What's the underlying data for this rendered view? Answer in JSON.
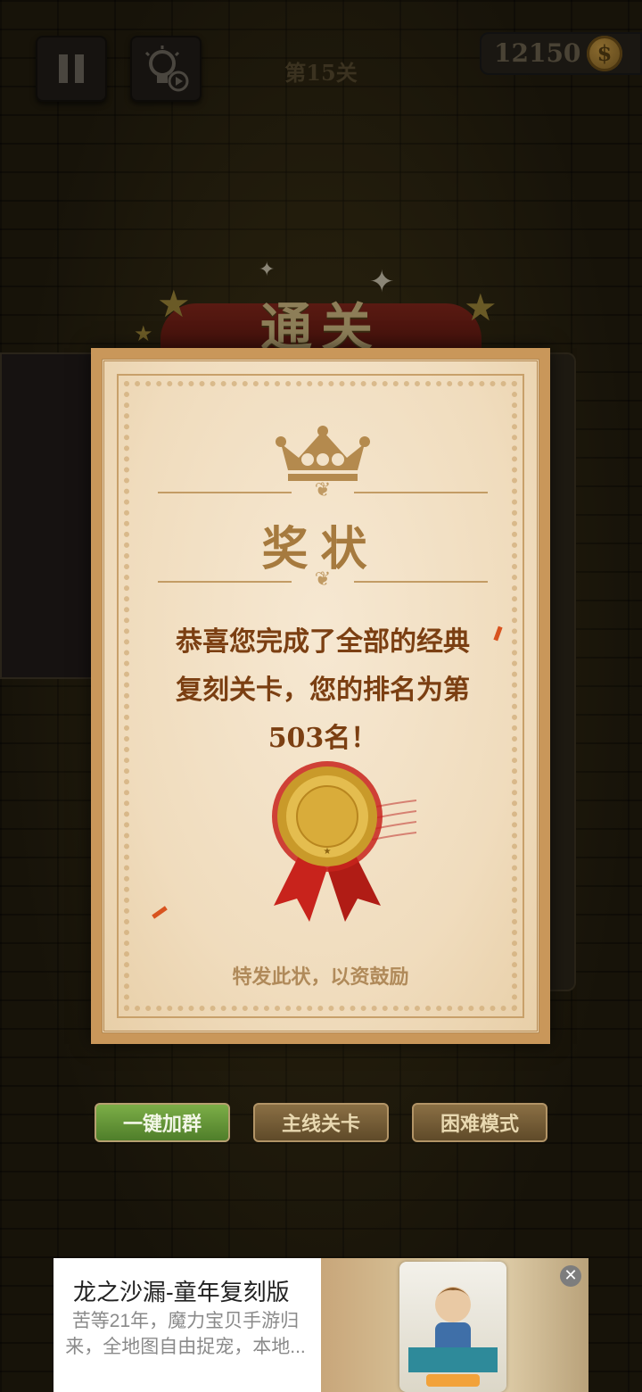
{
  "hud": {
    "level_title": "第15关",
    "coins": "12150",
    "coin_symbol": "$"
  },
  "banner": {
    "title": "通关"
  },
  "certificate": {
    "title": "奖状",
    "message": "恭喜您完成了全部的经典复刻关卡，您的排名为第503名！",
    "closing": "特发此状，以资鼓励"
  },
  "buttons": {
    "join_group": "一键加群",
    "main_levels": "主线关卡",
    "hard_mode": "困难模式"
  },
  "ad": {
    "title": "龙之沙漏-童年复刻版",
    "description": "苦等21年，魔力宝贝手游归来，全地图自由捉宠，本地...",
    "close_symbol": "✕"
  },
  "colors": {
    "accent_green": "#5f8e33",
    "accent_brown": "#6f5634",
    "cert_text": "#7b3f12"
  }
}
